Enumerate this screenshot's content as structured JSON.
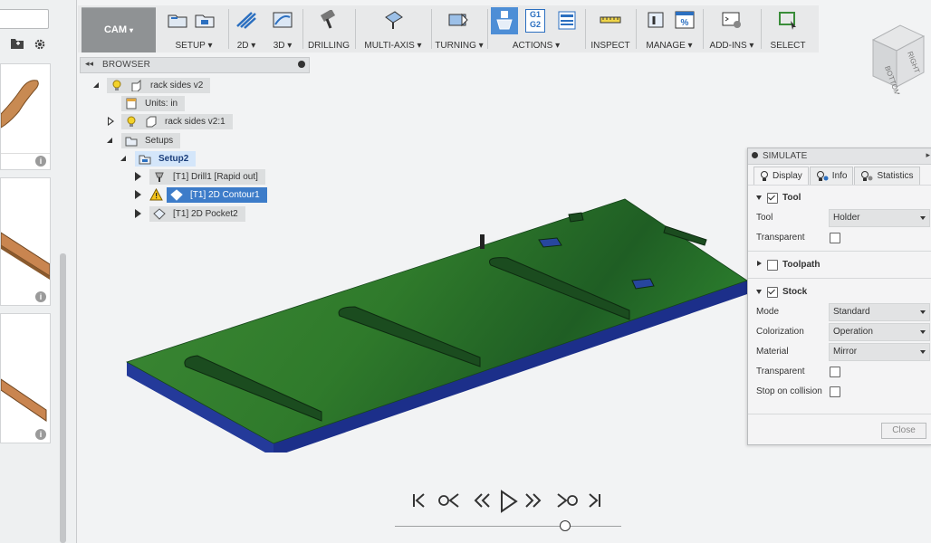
{
  "toolbar": {
    "cam_label": "CAM",
    "groups": [
      {
        "label": "SETUP ▾"
      },
      {
        "label": "2D ▾"
      },
      {
        "label": "3D ▾"
      },
      {
        "label": "DRILLING"
      },
      {
        "label": "MULTI-AXIS ▾"
      },
      {
        "label": "TURNING ▾"
      },
      {
        "label": "ACTIONS ▾"
      },
      {
        "label": "INSPECT"
      },
      {
        "label": "MANAGE ▾"
      },
      {
        "label": "ADD-INS ▾"
      },
      {
        "label": "SELECT"
      }
    ],
    "g1g2": [
      "G1",
      "G2"
    ]
  },
  "browser": {
    "title": "BROWSER",
    "tree": [
      {
        "label": "rack sides v2"
      },
      {
        "label": "Units: in"
      },
      {
        "label": "rack sides v2:1"
      },
      {
        "label": "Setups"
      },
      {
        "label": "Setup2"
      },
      {
        "label": "[T1] Drill1 [Rapid out]"
      },
      {
        "label": "[T1] 2D Contour1"
      },
      {
        "label": "[T1] 2D Pocket2"
      }
    ]
  },
  "viewcube": {
    "face_top": "BOTTOM",
    "face_right": "RIGHT"
  },
  "simulate": {
    "title": "SIMULATE",
    "tabs": [
      {
        "label": "Display"
      },
      {
        "label": "Info"
      },
      {
        "label": "Statistics"
      }
    ],
    "tool_section": "Tool",
    "tool_label": "Tool",
    "tool_value": "Holder",
    "transparent_label": "Transparent",
    "toolpath_section": "Toolpath",
    "stock_section": "Stock",
    "mode_label": "Mode",
    "mode_value": "Standard",
    "colorization_label": "Colorization",
    "colorization_value": "Operation",
    "material_label": "Material",
    "material_value": "Mirror",
    "stock_transparent_label": "Transparent",
    "stop_on_collision_label": "Stop on collision",
    "close_label": "Close"
  },
  "colors": {
    "stock": "#2e7a2a",
    "stock_edge": "#1c2f8a",
    "accent": "#3d7cc9"
  },
  "playback": {
    "timeline_progress": 0.75
  }
}
